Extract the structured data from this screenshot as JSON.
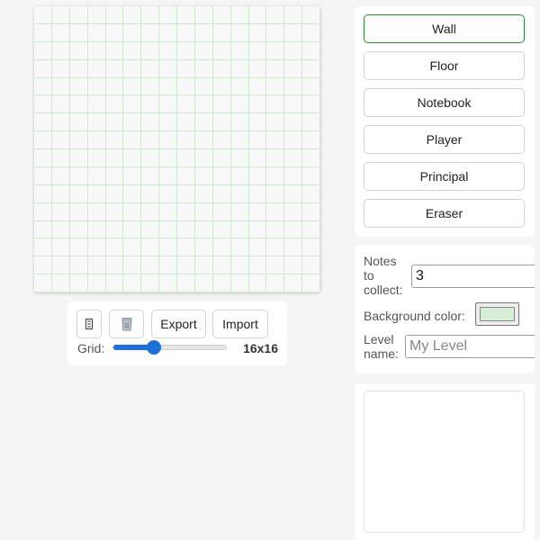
{
  "editor": {
    "grid_cols": 16,
    "grid_rows": 16,
    "grid_line_color": "#cfe8cf",
    "cell_color": "#f8f8f8"
  },
  "toolbar": {
    "undo_icon": "hourglass-icon",
    "clear_icon": "trash-icon",
    "export_label": "Export",
    "import_label": "Import",
    "grid_label": "Grid:",
    "grid_size_text": "16x16",
    "slider_value_fraction": 0.36,
    "accent_color": "#1e6fd9"
  },
  "tiles": {
    "items": [
      {
        "label": "Wall",
        "active": true
      },
      {
        "label": "Floor",
        "active": false
      },
      {
        "label": "Notebook",
        "active": false
      },
      {
        "label": "Player",
        "active": false
      },
      {
        "label": "Principal",
        "active": false
      },
      {
        "label": "Eraser",
        "active": false
      }
    ],
    "active_color": "#2e8b3a"
  },
  "settings": {
    "notes_label": "Notes to collect:",
    "notes_value": "3",
    "bg_color_label": "Background color:",
    "bg_color_value": "#d9eed9",
    "level_name_label": "Level name:",
    "level_name_placeholder": "My Level",
    "level_name_value": ""
  }
}
